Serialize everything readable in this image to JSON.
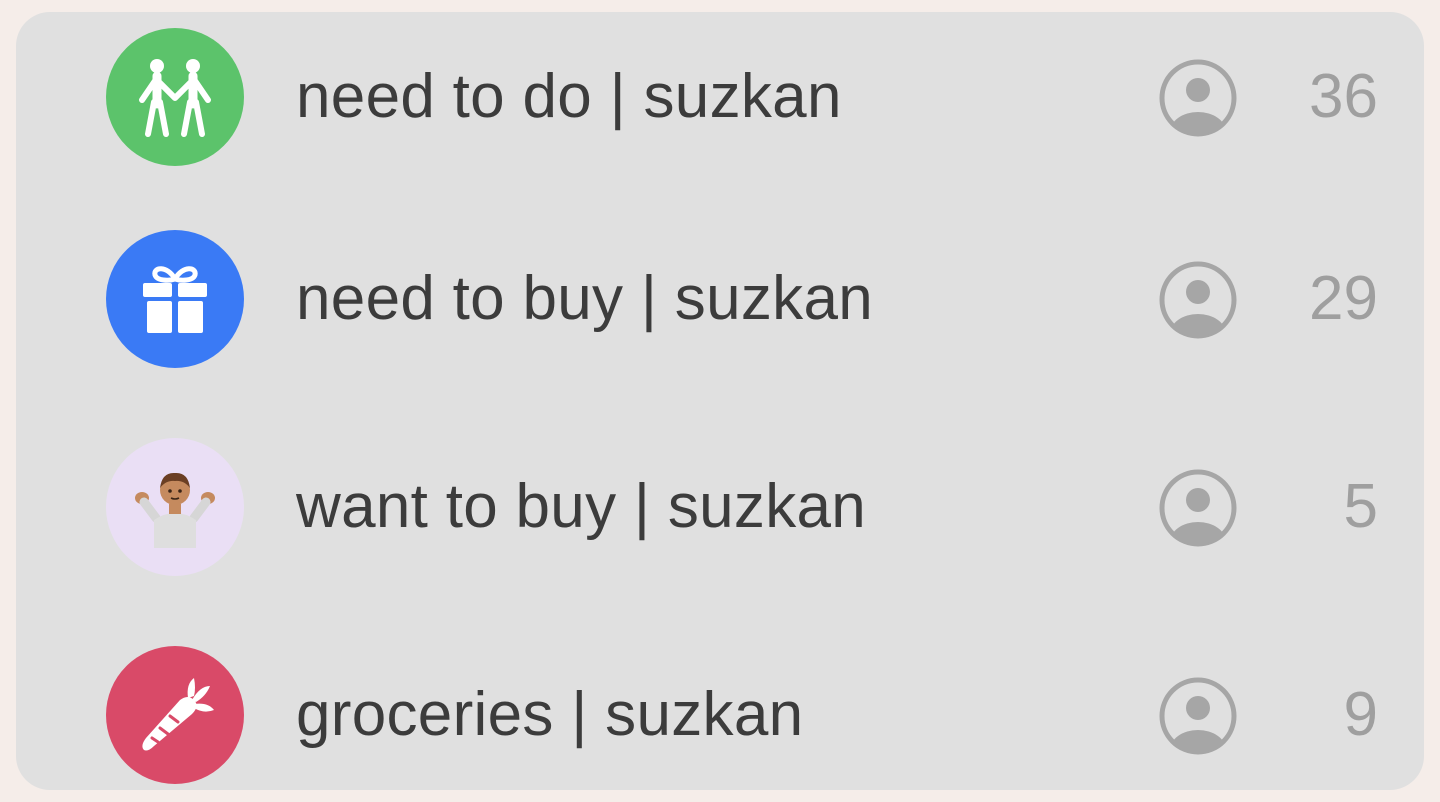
{
  "lists": [
    {
      "label": "need to do | suzkan",
      "count": "36",
      "icon": "people-holding-hands-icon",
      "color": "#5cc36b"
    },
    {
      "label": "need to buy | suzkan",
      "count": "29",
      "icon": "gift-icon",
      "color": "#3a7af5"
    },
    {
      "label": "want to buy | suzkan",
      "count": "5",
      "icon": "person-shrugging-emoji",
      "color": "#eadff5"
    },
    {
      "label": "groceries | suzkan",
      "count": "9",
      "icon": "carrot-icon",
      "color": "#d94a68"
    }
  ],
  "shared_icon": "shared-person-icon"
}
